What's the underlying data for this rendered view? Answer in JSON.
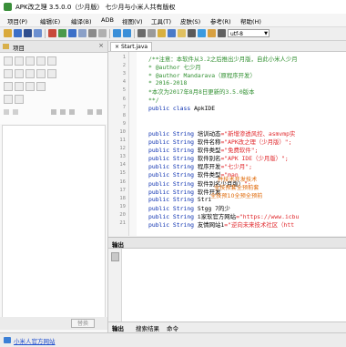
{
  "window": {
    "title": "APK改之理 3.5.0.0（少月版） 七少月与小米人共有版权"
  },
  "menubar": {
    "items": [
      "项目(P)",
      "编辑(E)",
      "编译(B)",
      "ADB",
      "视图(V)",
      "工具(T)",
      "皮肤(S)",
      "参考(R)",
      "帮助(H)"
    ]
  },
  "toolbar": {
    "encoding": "utf-8"
  },
  "left_panel": {
    "title": "项目",
    "replace_button": "替换"
  },
  "editor": {
    "tab_label": "Start.java",
    "code_lines": [
      {
        "n": "1",
        "parts": [
          {
            "t": "/**注意：本软件从3.2之后推出少月版，自此小米人少月",
            "c": "c-green"
          }
        ]
      },
      {
        "n": "2",
        "parts": [
          {
            "t": " * @author 七少月",
            "c": "c-green"
          }
        ]
      },
      {
        "n": "3",
        "parts": [
          {
            "t": " * @author Mandarava（原程序开发）",
            "c": "c-green"
          }
        ]
      },
      {
        "n": "4",
        "parts": [
          {
            "t": " * 2016-2018",
            "c": "c-green"
          }
        ]
      },
      {
        "n": "5",
        "parts": [
          {
            "t": " *本次为2017年8月8日更新的3.5.0版本",
            "c": "c-green"
          }
        ]
      },
      {
        "n": "6",
        "parts": [
          {
            "t": " **/",
            "c": "c-green"
          }
        ]
      },
      {
        "n": "7",
        "parts": [
          {
            "t": "public class ",
            "c": "c-blue"
          },
          {
            "t": "ApkIDE",
            "c": ""
          }
        ]
      },
      {
        "n": "8",
        "parts": [
          {
            "t": "",
            "c": ""
          }
        ]
      },
      {
        "n": "9",
        "parts": [
          {
            "t": "",
            "c": ""
          }
        ]
      },
      {
        "n": "10",
        "parts": [
          {
            "t": "    public String ",
            "c": "c-blue"
          },
          {
            "t": "培训动态",
            "c": ""
          },
          {
            "t": "=\"新增渗透风控、asmvmp实",
            "c": "c-red"
          }
        ]
      },
      {
        "n": "11",
        "parts": [
          {
            "t": "    public String ",
            "c": "c-blue"
          },
          {
            "t": "软件名称",
            "c": ""
          },
          {
            "t": "=\"APK改之理（少月版）\";",
            "c": "c-red"
          }
        ]
      },
      {
        "n": "12",
        "parts": [
          {
            "t": "    public String ",
            "c": "c-blue"
          },
          {
            "t": "软件类型",
            "c": ""
          },
          {
            "t": "=\"免费软件\";",
            "c": "c-red"
          }
        ]
      },
      {
        "n": "13",
        "parts": [
          {
            "t": "    public String ",
            "c": "c-blue"
          },
          {
            "t": "软件别名",
            "c": ""
          },
          {
            "t": "=\"APK IDE（少月版）\";",
            "c": "c-red"
          }
        ]
      },
      {
        "n": "14",
        "parts": [
          {
            "t": "    public String ",
            "c": "c-blue"
          },
          {
            "t": "程序开发",
            "c": ""
          },
          {
            "t": "=\"七少月\";",
            "c": "c-red"
          }
        ]
      },
      {
        "n": "15",
        "parts": [
          {
            "t": "    public String ",
            "c": "c-blue"
          },
          {
            "t": "软件类型",
            "c": ""
          },
          {
            "t": "=\"man",
            "c": "c-red"
          }
        ]
      },
      {
        "n": "16",
        "parts": [
          {
            "t": "    public String ",
            "c": "c-blue"
          },
          {
            "t": "软件别名少月版）",
            "c": ""
          },
          {
            "t": "\";",
            "c": "c-red"
          }
        ]
      },
      {
        "n": "17",
        "parts": [
          {
            "t": "    public String ",
            "c": "c-blue"
          },
          {
            "t": "软件开发",
            "c": ""
          }
        ]
      },
      {
        "n": "18",
        "parts": [
          {
            "t": "    public String ",
            "c": "c-blue"
          },
          {
            "t": "Stri",
            "c": ""
          }
        ]
      },
      {
        "n": "19",
        "parts": [
          {
            "t": "    public String ",
            "c": "c-blue"
          },
          {
            "t": "Stgg 7的少",
            "c": ""
          }
        ]
      },
      {
        "n": "20",
        "parts": [
          {
            "t": "    public String ",
            "c": "c-blue"
          },
          {
            "t": "i家软官方网站",
            "c": ""
          },
          {
            "t": "=\"https://www.icbu",
            "c": "c-red"
          }
        ]
      },
      {
        "n": "21",
        "parts": [
          {
            "t": "    public String ",
            "c": "c-blue"
          },
          {
            "t": "友情网站1",
            "c": ""
          },
          {
            "t": "=\"逆向未来技术社区（htt",
            "c": "c-red"
          }
        ]
      }
    ],
    "overlay_lines": [
      "并技术开发技术",
      "全技预套全预前套",
      "全技预10全预全预前"
    ]
  },
  "output": {
    "title": "输出",
    "tabs": [
      "输出",
      "搜索结果",
      "命令"
    ]
  },
  "statusbar": {
    "link": "小米人官方网站"
  },
  "colors": {
    "code_comment": "#2f8f2f",
    "code_keyword": "#0a2fb0",
    "code_string": "#e0262a",
    "overlay_text": "#e06b0a"
  }
}
